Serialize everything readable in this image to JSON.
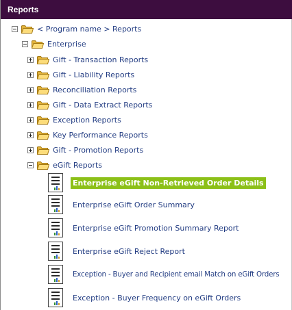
{
  "panel": {
    "title": "Reports"
  },
  "tree": {
    "root": {
      "label": "< Program name > Reports",
      "expanded": true
    },
    "enterprise": {
      "label": "Enterprise",
      "expanded": true
    },
    "folders": [
      {
        "label": "Gift - Transaction Reports",
        "expanded": false
      },
      {
        "label": "Gift - Liability Reports",
        "expanded": false
      },
      {
        "label": "Reconciliation Reports",
        "expanded": false
      },
      {
        "label": "Gift - Data Extract Reports",
        "expanded": false
      },
      {
        "label": "Exception Reports",
        "expanded": false
      },
      {
        "label": "Key Performance Reports",
        "expanded": false
      },
      {
        "label": "Gift - Promotion Reports",
        "expanded": false
      },
      {
        "label": "eGift Reports",
        "expanded": true
      }
    ],
    "egift_reports": [
      {
        "label": "Enterprise eGift Non-Retrieved Order Details",
        "selected": true
      },
      {
        "label": "Enterprise eGift Order Summary",
        "selected": false
      },
      {
        "label": "Enterprise eGift Promotion Summary Report",
        "selected": false
      },
      {
        "label": "Enterprise eGift Reject Report",
        "selected": false
      },
      {
        "label": "Exception - Buyer and Recipient email Match on eGift Orders",
        "selected": false
      },
      {
        "label": "Exception - Buyer Frequency on eGift Orders",
        "selected": false
      }
    ]
  },
  "colors": {
    "header_bg": "#3d0d3f",
    "link": "#223c82",
    "selected_bg": "#8cc018"
  }
}
